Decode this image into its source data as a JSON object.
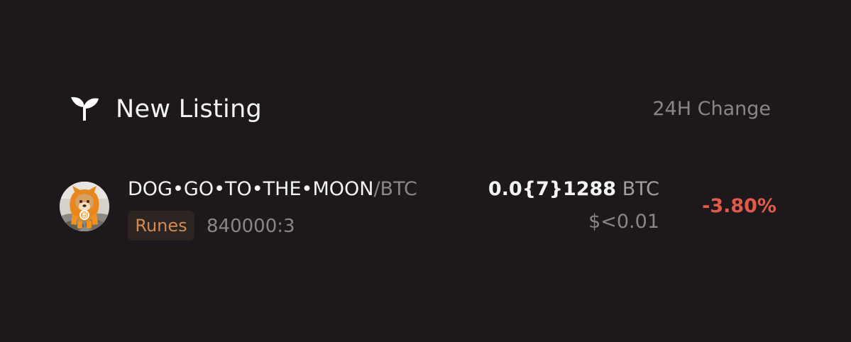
{
  "header": {
    "title": "New Listing",
    "change_label": "24H Change"
  },
  "listing": {
    "avatar": "dog-avatar",
    "pair_base": "DOG•GO•TO•THE•MOON",
    "pair_quote": "/BTC",
    "badge": "Runes",
    "rune_id": "840000:3",
    "price_btc": "0.0{7}1288",
    "price_unit": "BTC",
    "price_usd": "$<0.01",
    "change": "-3.80%"
  },
  "colors": {
    "background": "#1c181b",
    "primary_text": "#f4f4f4",
    "muted_text": "#8a8589",
    "rune_badge_bg": "#2c2421",
    "rune_badge_text": "#d28a55",
    "negative": "#e15a4a"
  },
  "icons": {
    "header": "seedling-icon"
  }
}
